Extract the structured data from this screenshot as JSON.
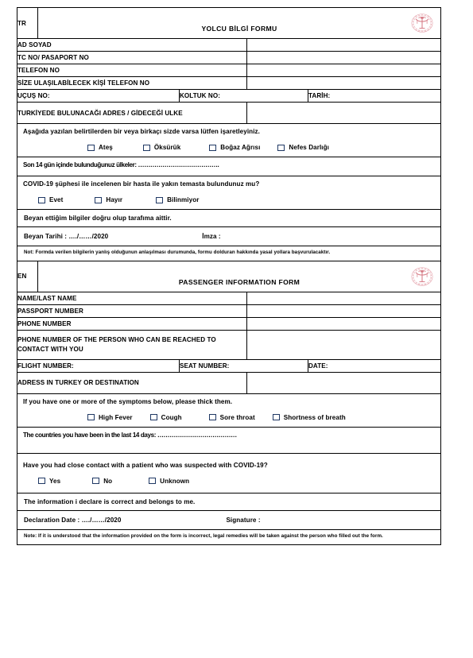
{
  "document": {
    "title_tr": "YOLCU BİLGİ FORMU",
    "title_en": "PASSENGER INFORMATION FORM",
    "lang_tr": "TR",
    "lang_en": "EN",
    "emblem_name": "turkish-ministry-of-health-emblem",
    "emblem_color": "#E8A0A8"
  },
  "tr": {
    "fields": [
      {
        "label": "AD    SOYAD",
        "value": ""
      },
      {
        "label": "TC NO/ PASAPORT NO",
        "value": ""
      },
      {
        "label": "TELEFON NO",
        "value": ""
      },
      {
        "label": "SİZE ULAŞILABİLECEK KİŞİ TELEFON  NO",
        "value": ""
      }
    ],
    "flight_row": {
      "flight_label": "UÇUŞ NO:",
      "flight_value": "",
      "seat_label": "KOLTUK NO:",
      "seat_value": "",
      "date_label": "TARİH:",
      "date_value": ""
    },
    "address": {
      "label": "TURKİYEDE BULUNACAĞI ADRES / GİDECEĞİ ULKE",
      "value": ""
    },
    "symptoms_instruction": "Aşağıda yazılan belirtilerden bir veya birkaçı sizde varsa lütfen işaretleyiniz.",
    "symptoms": [
      "Ateş",
      "Öksürük",
      "Boğaz Ağrısı",
      "Nefes Darlığı"
    ],
    "countries_question": "Son 14 gün içinde bulunduğunuz ülkeler: ………………………………….",
    "contact_question": "COVID-19 şüphesi ile incelenen bir hasta  ile yakın temasta bulundunuz mu?",
    "contact_options": [
      "Evet",
      "Hayır",
      "Bilinmiyor"
    ],
    "declaration": "Beyan ettiğim bilgiler doğru olup tarafıma aittir.",
    "declaration_date_label": "Beyan Tarihi : …./……/2020",
    "signature_label": "İmza :",
    "note": "Not: Formda verilen bilgilerin  yanlış olduğunun anlaşılması durumunda, formu dolduran hakkında yasal yollara  başvurulacaktır."
  },
  "en": {
    "fields": [
      {
        "label": "NAME/LAST NAME",
        "value": ""
      },
      {
        "label": "PASSPORT NUMBER",
        "value": ""
      },
      {
        "label": "PHONE NUMBER",
        "value": ""
      },
      {
        "label": "PHONE NUMBER OF THE PERSON  WHO CAN BE REACHED TO CONTACT WITH YOU",
        "value": ""
      }
    ],
    "flight_row": {
      "flight_label": "FLIGHT NUMBER:",
      "flight_value": "",
      "seat_label": "SEAT NUMBER:",
      "seat_value": "",
      "date_label": "DATE:",
      "date_value": ""
    },
    "address": {
      "label": "ADRESS IN TURKEY OR DESTINATION",
      "value": ""
    },
    "symptoms_instruction": "If you have one or more of the symptoms below, please thick them.",
    "symptoms": [
      "High Fever",
      "Cough",
      "Sore throat",
      "Shortness of breath"
    ],
    "countries_question": "The countries you have been in the last 14 days: …………………………………",
    "contact_question": "Have you had close contact with a patient who was suspected with COVID-19?",
    "contact_options": [
      "Yes",
      "No",
      "Unknown"
    ],
    "declaration": "The information i declare is correct and belongs to me.",
    "declaration_date_label": "Declaration Date : …./……/2020",
    "signature_label": "Signature :",
    "note": "Note: If it is understood that the information provided on the form is incorrect, legal remedies will be taken against the person who filled out the form."
  }
}
